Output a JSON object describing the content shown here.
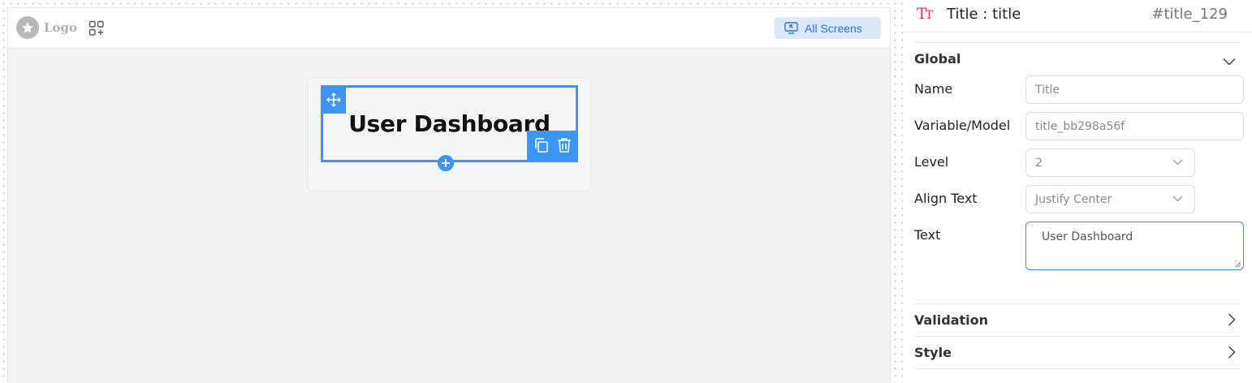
{
  "canvas": {
    "logo_text": "Logo",
    "all_screens_label": "All Screens",
    "component_title": "User Dashboard"
  },
  "panel": {
    "header": {
      "icon_text": "TT",
      "title": "Title : title",
      "id": "#title_129"
    },
    "sections": {
      "global": "Global",
      "validation": "Validation",
      "style": "Style"
    },
    "fields": {
      "name_label": "Name",
      "name_placeholder": "Title",
      "variable_label": "Variable/Model",
      "variable_value": "title_bb298a56f",
      "level_label": "Level",
      "level_value": "2",
      "align_label": "Align Text",
      "align_value": "Justify Center",
      "text_label": "Text",
      "text_value": "User Dashboard"
    }
  },
  "colors": {
    "accent": "#3b95f3",
    "title_icon": "#e8334a",
    "all_screens_bg": "#dbe9fb",
    "all_screens_text": "#2f6fd6"
  },
  "icons": [
    "star-icon",
    "apps-add-icon",
    "screen-share-icon",
    "move-icon",
    "copy-icon",
    "trash-icon",
    "plus-icon",
    "chevron-down-icon",
    "chevron-right-icon",
    "resize-grip-icon"
  ]
}
